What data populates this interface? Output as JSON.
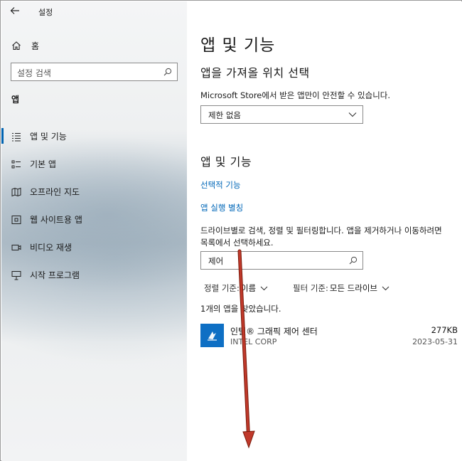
{
  "window": {
    "title": "설정"
  },
  "sidebar": {
    "home_label": "홈",
    "search_placeholder": "설정 검색",
    "section_title": "앱",
    "items": [
      {
        "label": "앱 및 기능",
        "icon": "apps-features-icon",
        "active": true
      },
      {
        "label": "기본 앱",
        "icon": "default-apps-icon",
        "active": false
      },
      {
        "label": "오프라인 지도",
        "icon": "offline-maps-icon",
        "active": false
      },
      {
        "label": "웹 사이트용 앱",
        "icon": "apps-for-websites-icon",
        "active": false
      },
      {
        "label": "비디오 재생",
        "icon": "video-playback-icon",
        "active": false
      },
      {
        "label": "시작 프로그램",
        "icon": "startup-icon",
        "active": false
      }
    ]
  },
  "main": {
    "page_title": "앱 및 기능",
    "install_section": {
      "title": "앱을 가져올 위치 선택",
      "description": "Microsoft Store에서 받은 앱만이 안전할 수 있습니다.",
      "dropdown_value": "제한 없음"
    },
    "apps_section": {
      "title": "앱 및 기능",
      "optional_features_link": "선택적 기능",
      "app_aliases_link": "앱 실행 별칭",
      "help_text_line1": "드라이브별로 검색, 정렬 및 필터링합니다. 앱을 제거하거나 이동하려면",
      "help_text_line2": "목록에서 선택하세요.",
      "search_value": "제어",
      "sort_label": "정렬 기준:",
      "sort_value": "이름",
      "filter_label": "필터 기준:",
      "filter_value": "모든 드라이브",
      "results_text": "1개의 앱을 찾았습니다."
    },
    "apps": [
      {
        "name": "인텔® 그래픽 제어 센터",
        "publisher": "INTEL CORP",
        "size": "277KB",
        "date": "2023-05-31",
        "icon": "intel-graphics-icon",
        "tile_color": "#0e6fc4"
      }
    ]
  },
  "annotation": {
    "arrow_color": "#c0392b"
  }
}
